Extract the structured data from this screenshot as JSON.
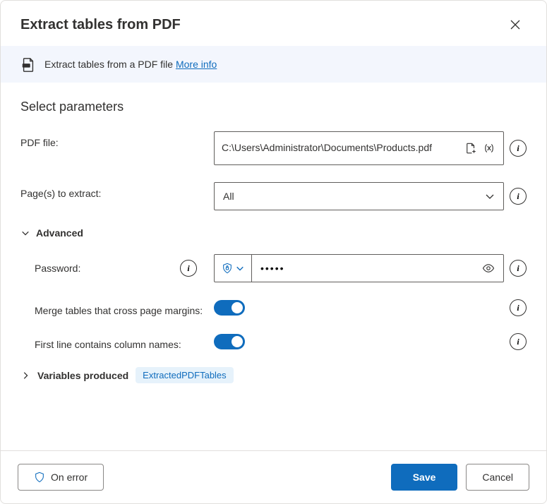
{
  "header": {
    "title": "Extract tables from PDF"
  },
  "banner": {
    "text": "Extract tables from a PDF file",
    "more_info": "More info"
  },
  "section_title": "Select parameters",
  "fields": {
    "pdf_file": {
      "label": "PDF file:",
      "value": "C:\\Users\\Administrator\\Documents\\Products.pdf"
    },
    "pages": {
      "label": "Page(s) to extract:",
      "value": "All"
    }
  },
  "advanced": {
    "label": "Advanced",
    "password": {
      "label": "Password:",
      "value": "•••••"
    },
    "merge": {
      "label": "Merge tables that cross page margins:",
      "value": true
    },
    "first_line": {
      "label": "First line contains column names:",
      "value": true
    }
  },
  "variables": {
    "label": "Variables produced",
    "badge": "ExtractedPDFTables"
  },
  "footer": {
    "on_error": "On error",
    "save": "Save",
    "cancel": "Cancel"
  }
}
